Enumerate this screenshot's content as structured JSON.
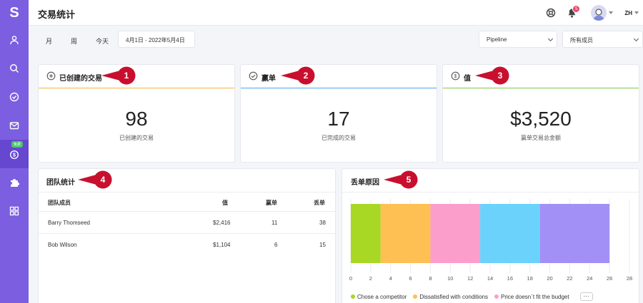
{
  "app": {
    "logo": "S",
    "title": "交易统计",
    "sidebar_badge": "免费"
  },
  "header": {
    "notifications": "5",
    "lang": "ZH"
  },
  "filters": {
    "period_month": "月",
    "period_week": "周",
    "period_today": "今天",
    "date_range": "4月1日 - 2022年5月4日",
    "pipeline": "Pipeline",
    "members": "所有成员"
  },
  "cards": [
    {
      "title": "已创建的交易",
      "value": "98",
      "sub": "已创建的交易",
      "accent": "#f3b53c",
      "callout": "1"
    },
    {
      "title": "赢单",
      "value": "17",
      "sub": "已完成的交易",
      "accent": "#4aa8e8",
      "callout": "2"
    },
    {
      "title": "值",
      "value": "$3,520",
      "sub": "赢单交易总金额",
      "accent": "#7fc84a",
      "callout": "3"
    }
  ],
  "team": {
    "title": "团队统计",
    "callout": "4",
    "headers": {
      "member": "团队成员",
      "value": "值",
      "won": "赢单",
      "lost": "丢单"
    },
    "rows": [
      {
        "member": "Barry Thomseed",
        "value": "$2,416",
        "won": "11",
        "lost": "38"
      },
      {
        "member": "Bob Wilson",
        "value": "$1,104",
        "won": "6",
        "lost": "15"
      }
    ]
  },
  "lost_reasons": {
    "title": "丢单原因",
    "callout": "5",
    "more": "···"
  },
  "chart_data": {
    "type": "bar",
    "orientation": "horizontal-stacked",
    "series": [
      {
        "name": "Chose a competitor",
        "value": 3,
        "color": "#a8d824"
      },
      {
        "name": "Dissatisfied with conditions",
        "value": 5,
        "color": "#fec052"
      },
      {
        "name": "Price doesn`t fit the budget",
        "value": 5,
        "color": "#fb9ecc"
      },
      {
        "name": "",
        "value": 6,
        "color": "#6bd3fb"
      },
      {
        "name": "",
        "value": 7,
        "color": "#a390f7"
      }
    ],
    "xlim": [
      0,
      28
    ],
    "xticks": [
      "0",
      "2",
      "4",
      "6",
      "8",
      "10",
      "12",
      "14",
      "16",
      "18",
      "20",
      "22",
      "24",
      "26",
      "28"
    ],
    "grid": true
  },
  "colors": {
    "sidebar": "#7b5fe0",
    "callout": "#c8102e"
  }
}
